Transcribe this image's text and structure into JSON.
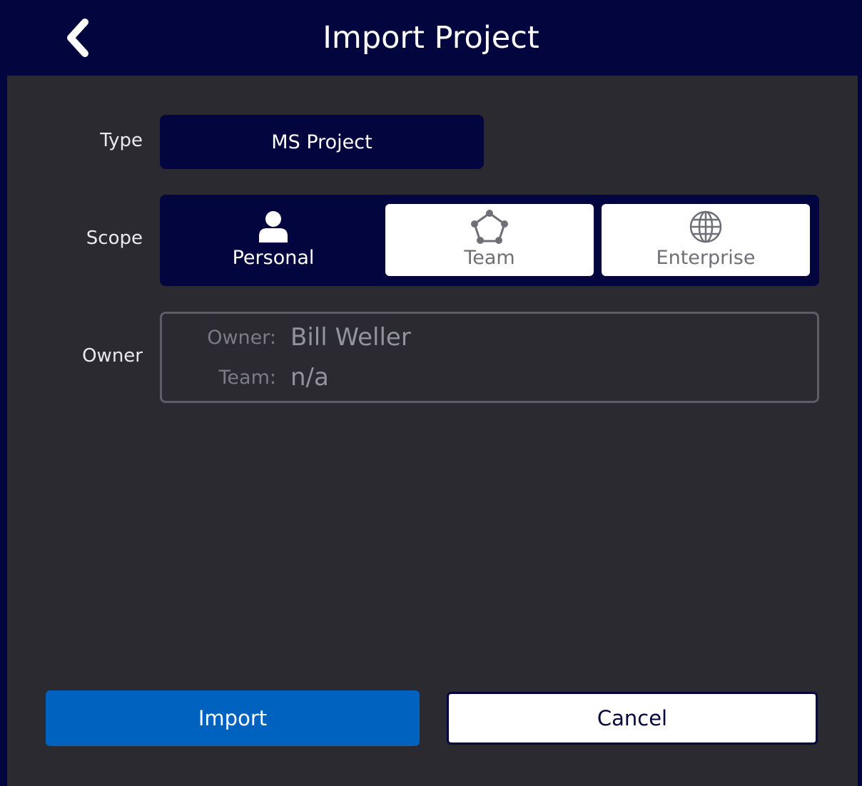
{
  "header": {
    "title": "Import Project",
    "back_icon": "chevron-left-icon"
  },
  "form": {
    "type": {
      "label": "Type",
      "value": "MS Project"
    },
    "scope": {
      "label": "Scope",
      "selected": "Personal",
      "options": [
        {
          "label": "Personal",
          "icon": "user-icon"
        },
        {
          "label": "Team",
          "icon": "team-icon"
        },
        {
          "label": "Enterprise",
          "icon": "globe-icon"
        }
      ]
    },
    "owner": {
      "label": "Owner",
      "owner_key": "Owner:",
      "owner_value": "Bill Weller",
      "team_key": "Team:",
      "team_value": "n/a"
    }
  },
  "actions": {
    "import_label": "Import",
    "cancel_label": "Cancel"
  },
  "colors": {
    "header_bg": "#03053f",
    "panel_bg": "#2a2a30",
    "primary_button": "#0062bf",
    "selected_option": "#03053f",
    "unselected_option": "#ffffff"
  }
}
